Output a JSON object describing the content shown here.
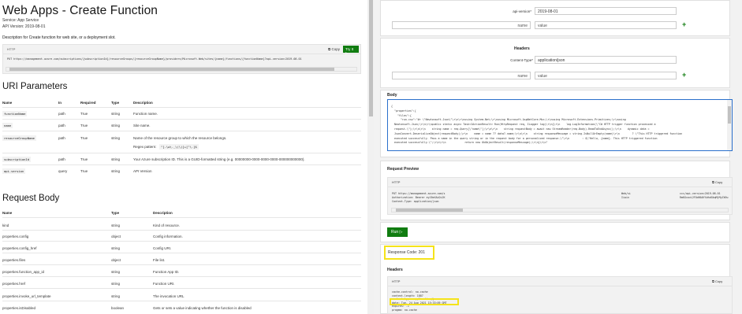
{
  "doc": {
    "title": "Web Apps - Create Function",
    "service": "Service:  App Service",
    "api_version": "API Version:  2019-08-01",
    "description": "Description for Create function for web site, or a deployment slot.",
    "code": {
      "label": "HTTP",
      "copy": "Copy",
      "tryit": "Try It",
      "url": "PUT https://management.azure.com/subscriptions/{subscriptionId}/resourceGroups/{resourceGroupName}/providers/Microsoft.Web/sites/{name}/functions/{functionName}?api-version=2019-08-01"
    },
    "uri_heading": "URI Parameters",
    "uri_headers": [
      "Name",
      "In",
      "Required",
      "Type",
      "Description"
    ],
    "uri_rows": [
      {
        "name": "functionName",
        "in": "path",
        "req": "True",
        "type": "string",
        "desc": "Function name."
      },
      {
        "name": "name",
        "in": "path",
        "req": "True",
        "type": "string",
        "desc": "Site name."
      },
      {
        "name": "resourceGroupName",
        "in": "path",
        "req": "True",
        "type": "string",
        "desc": "Name of the resource group to which the resource belongs.",
        "pattern_label": "Regex pattern:",
        "pattern": "^[-\\w\\._\\(\\)]+[^\\.]$"
      },
      {
        "name": "subscriptionId",
        "in": "path",
        "req": "True",
        "type": "string",
        "desc": "Your Azure subscription ID. This is a GUID-formatted string (e.g. 00000000-0000-0000-0000-000000000000)."
      },
      {
        "name": "api-version",
        "in": "query",
        "req": "True",
        "type": "string",
        "desc": "API Version"
      }
    ],
    "body_heading": "Request Body",
    "body_headers": [
      "Name",
      "Type",
      "Description"
    ],
    "body_rows": [
      {
        "name": "kind",
        "type": "string",
        "desc": "Kind of resource."
      },
      {
        "name": "properties.config",
        "type": "object",
        "desc": "Config information."
      },
      {
        "name": "properties.config_href",
        "type": "string",
        "desc": "Config URI."
      },
      {
        "name": "properties.files",
        "type": "object",
        "desc": "File list."
      },
      {
        "name": "properties.function_app_id",
        "type": "string",
        "desc": "Function App ID."
      },
      {
        "name": "properties.href",
        "type": "string",
        "desc": "Function URI."
      },
      {
        "name": "properties.invoke_url_template",
        "type": "string",
        "desc": "The invocation URL"
      },
      {
        "name": "properties.isDisabled",
        "type": "boolean",
        "desc": "Gets or sets a value indicating whether the function is disabled"
      }
    ]
  },
  "tryit": {
    "param_label": "api-version*",
    "param_value": "2019-08-01",
    "name_ph": "name",
    "value_ph": "value",
    "headers_title": "Headers",
    "ct_label": "Content-Type*",
    "ct_value": "application/json",
    "body_title": "Body",
    "body_text": "{\n  \"properties\":{\n    \"files\":{\n      \"run.csx\":\"#r \\\"Newtonsoft.Json\\\"\\r\\n\\r\\nusing System.Net;\\r\\nusing Microsoft.AspNetCore.Mvc;\\r\\nusing Microsoft.Extensions.Primitives;\\r\\nusing\n  Newtonsoft.Json;\\r\\n\\r\\npublic static async Task<IActionResult> Run(HttpRequest req, ILogger log)\\r\\n{\\r\\n    log.LogInformation(\\\"C# HTTP trigger function processed a\n  request.\\\");\\r\\n\\r\\n    string name = req.Query[\\\"name\\\"];\\r\\n\\r\\n    string requestBody = await new StreamReader(req.Body).ReadToEndAsync();\\r\\n    dynamic data =\n  JsonConvert.DeserializeObject(requestBody);\\r\\n    name = name ?? data?.name;\\r\\n\\r\\n    string responseMessage = string.IsNullOrEmpty(name)\\r\\n        ? \\\"This HTTP triggered function\n  executed successfully. Pass a name in the query string or in the request body for a personalized response.\\\"\\r\\n        : $\\\"Hello, {name}. This HTTP triggered function\n  executed successfully.\\\";\\r\\n\\r\\n            return new OkObjectResult(responseMessage);\\r\\n}\\r\\n\"",
    "preview_title": "Request Preview",
    "preview_label": "HTTP",
    "preview_copy": "Copy",
    "preview_l1a": "PUT https://management.azure.com/s",
    "preview_l1b": "Web/si",
    "preview_l1c": "ccc/api-version=2019-08-01",
    "preview_l2a": "Authorization: Bearer eyJ0eXAiOiJK",
    "preview_l2b": "Iiwin",
    "preview_l2c": "RmKGcovL2FOdHA0YXdhdGkqMjMyZk9u",
    "preview_l3": "Content-Type: application/json",
    "run_label": "Run",
    "response_code": "Response Code: 201",
    "resp_headers_title": "Headers",
    "resp_label": "HTTP",
    "resp_copy": "Copy",
    "resp_lines": [
      "cache-control: no-cache",
      "content-length: 1887",
      "content-type: application/json",
      "date: Tue, 24 Aug 2021 15:33:09 GMT",
      "expires: -1",
      "pragma: no-cache"
    ]
  },
  "colors": {
    "accent": "#107c10",
    "highlight": "#f5e31a",
    "focus": "#2a6fcb"
  }
}
